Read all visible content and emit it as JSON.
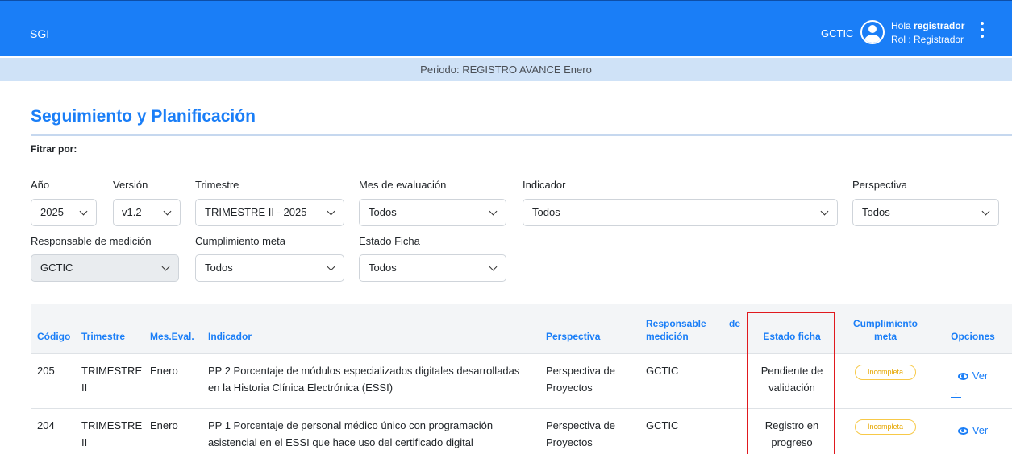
{
  "header": {
    "brand": "SGI",
    "user_code": "GCTIC",
    "greeting_prefix": "Hola ",
    "greeting_user": "registrador",
    "role": "Rol : Registrador",
    "avatar_icon": "user-circle-icon",
    "menu_icon": "kebab-menu-icon",
    "bg_color": "#1a7ef7"
  },
  "period": "Periodo: REGISTRO AVANCE Enero",
  "page": {
    "title": "Seguimiento y Planificación",
    "filter_label": "Fitrar por:"
  },
  "filters": {
    "anio": {
      "label": "Año",
      "value": "2025"
    },
    "version": {
      "label": "Versión",
      "value": "v1.2"
    },
    "trimestre": {
      "label": "Trimestre",
      "value": "TRIMESTRE II - 2025"
    },
    "mes": {
      "label": "Mes de evaluación",
      "value": "Todos"
    },
    "indicador": {
      "label": "Indicador",
      "value": "Todos"
    },
    "perspectiva": {
      "label": "Perspectiva",
      "value": "Todos"
    },
    "responsable": {
      "label": "Responsable de medición",
      "value": "GCTIC"
    },
    "cumplimiento": {
      "label": "Cumplimiento meta",
      "value": "Todos"
    },
    "estado": {
      "label": "Estado Ficha",
      "value": "Todos"
    }
  },
  "table": {
    "headers": {
      "codigo": "Código",
      "trimestre": "Trimestre",
      "mes": "Mes.Eval.",
      "indicador": "Indicador",
      "perspectiva": "Perspectiva",
      "responsable_a": "Responsable",
      "responsable_de": "de",
      "responsable_b": "medición",
      "estado": "Estado ficha",
      "cumplimiento": "Cumplimiento meta",
      "opciones": "Opciones"
    },
    "rows": [
      {
        "codigo": "205",
        "trimestre": "TRIMESTRE II",
        "mes": "Enero",
        "indicador": "PP 2 Porcentaje de módulos especializados digitales desarrolladas en la Historia Clínica Electrónica (ESSI)",
        "perspectiva": "Perspectiva de Proyectos",
        "responsable": "GCTIC",
        "estado": "Pendiente de validación",
        "cumplimiento": "Incompleta",
        "ver": "Ver"
      },
      {
        "codigo": "204",
        "trimestre": "TRIMESTRE II",
        "mes": "Enero",
        "indicador": "PP 1 Porcentaje de personal médico único con programación asistencial en el ESSI que hace uso del certificado digital",
        "perspectiva": "Perspectiva de Proyectos",
        "responsable": "GCTIC",
        "estado": "Registro en progreso",
        "cumplimiento": "Incompleta",
        "ver": "Ver"
      }
    ]
  },
  "colors": {
    "accent": "#1a7ef7",
    "period_bg": "#cfe2f7",
    "badge": "#f7c948",
    "highlight": "#e0191e"
  }
}
